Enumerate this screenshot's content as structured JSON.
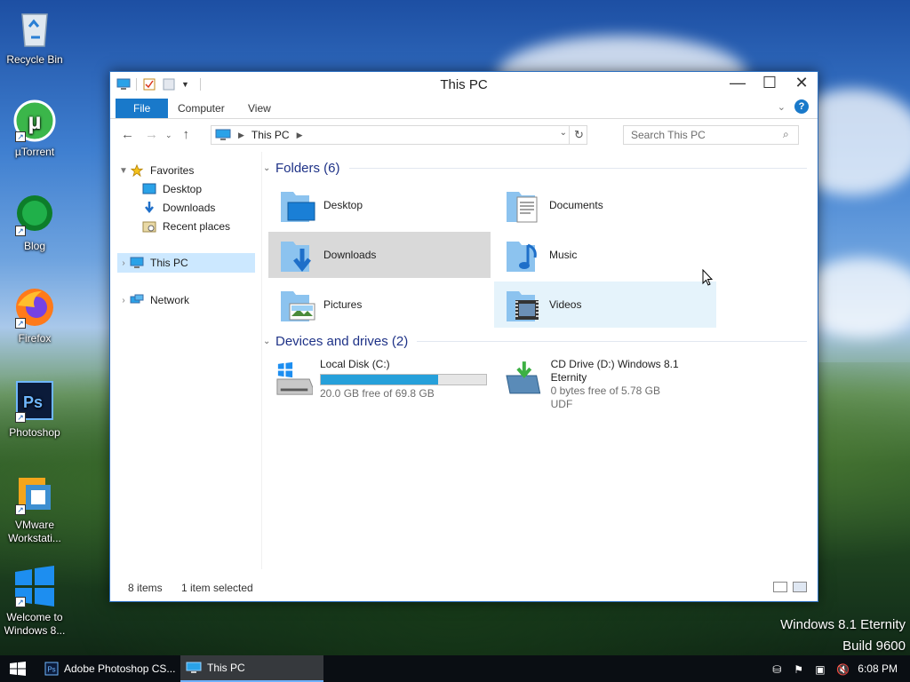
{
  "desktop": {
    "icons": [
      {
        "label": "Recycle Bin"
      },
      {
        "label": "µTorrent"
      },
      {
        "label": "Blog"
      },
      {
        "label": "Firefox"
      },
      {
        "label": "Photoshop"
      },
      {
        "label": "VMware Workstati..."
      },
      {
        "label": "Welcome to Windows 8..."
      }
    ],
    "watermark": {
      "line1": "Windows 8.1 Eternity",
      "line2": "Build 9600"
    }
  },
  "window": {
    "title": "This PC",
    "ribbon_tabs": [
      "File",
      "Computer",
      "View"
    ],
    "address": {
      "path": "This PC"
    },
    "search": {
      "placeholder": "Search This PC"
    },
    "nav_pane": {
      "favorites": "Favorites",
      "items": [
        "Desktop",
        "Downloads",
        "Recent places"
      ],
      "this_pc": "This PC",
      "network": "Network"
    },
    "folders_header": "Folders (6)",
    "folders": [
      "Desktop",
      "Documents",
      "Downloads",
      "Music",
      "Pictures",
      "Videos"
    ],
    "devices_header": "Devices and drives (2)",
    "drives": [
      {
        "name": "Local Disk (C:)",
        "free": "20.0 GB free of 69.8 GB",
        "used_fraction": 0.71
      },
      {
        "name": "CD Drive (D:) Windows 8.1 Eternity",
        "free": "0 bytes free of 5.78 GB",
        "fs": "UDF"
      }
    ],
    "status": {
      "items": "8 items",
      "selected": "1 item selected"
    }
  },
  "taskbar": {
    "buttons": [
      "Adobe Photoshop CS...",
      "This PC"
    ],
    "clock": "6:08 PM"
  },
  "colors": {
    "accent": "#1979ca",
    "folder": "#8cc3ef",
    "selection": "#cce8ff"
  }
}
